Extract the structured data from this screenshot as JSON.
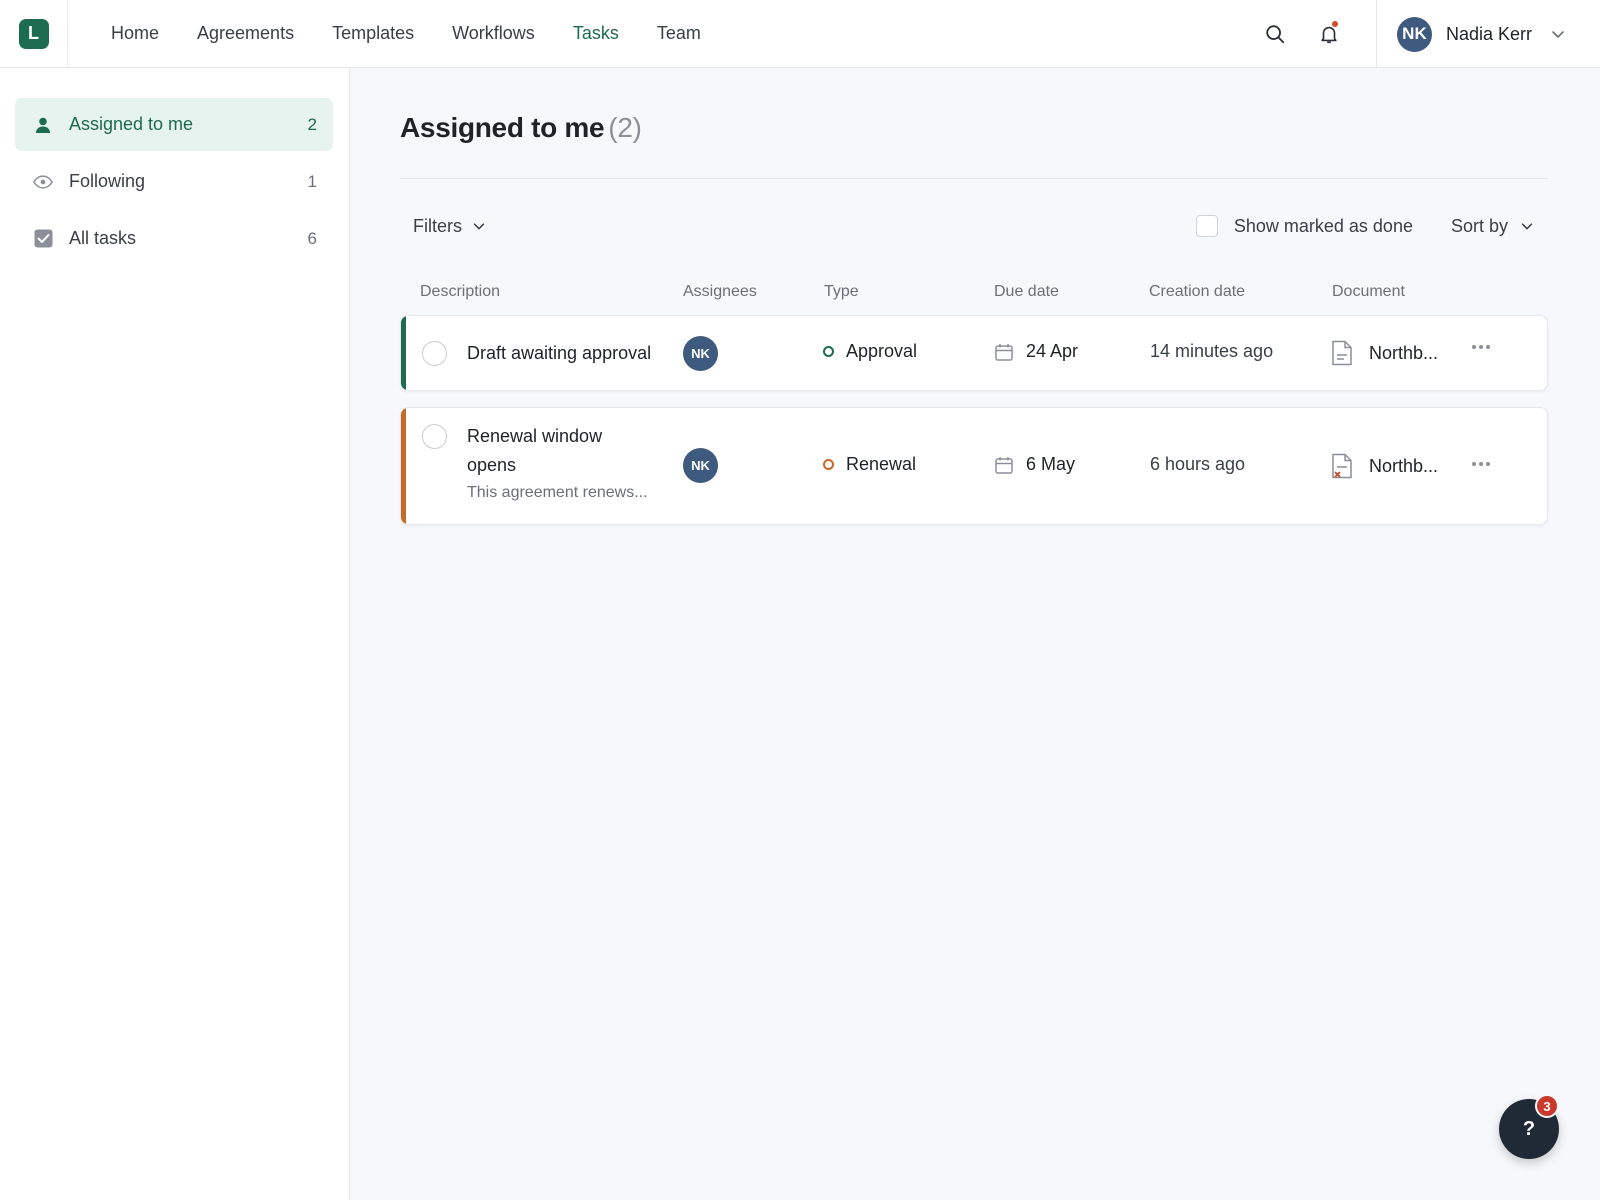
{
  "app": {
    "logo_letter": "L",
    "brand_color": "#1d6b50"
  },
  "nav": {
    "items": [
      {
        "label": "Home",
        "active": false
      },
      {
        "label": "Agreements",
        "active": false
      },
      {
        "label": "Templates",
        "active": false
      },
      {
        "label": "Workflows",
        "active": false
      },
      {
        "label": "Tasks",
        "active": true
      },
      {
        "label": "Team",
        "active": false
      }
    ]
  },
  "user": {
    "initials": "NK",
    "name": "Nadia Kerr"
  },
  "sidebar": {
    "items": [
      {
        "label": "Assigned to me",
        "count": "2",
        "icon": "person-icon",
        "active": true
      },
      {
        "label": "Following",
        "count": "1",
        "icon": "eye-icon",
        "active": false
      },
      {
        "label": "All tasks",
        "count": "6",
        "icon": "checkbox-icon",
        "active": false
      }
    ]
  },
  "main": {
    "title": "Assigned to me",
    "title_count": "(2)",
    "filters_label": "Filters",
    "show_done_label": "Show marked as done",
    "sort_label": "Sort by",
    "columns": {
      "description": "Description",
      "assignees": "Assignees",
      "type": "Type",
      "due": "Due date",
      "created": "Creation date",
      "document": "Document"
    },
    "tasks": [
      {
        "description": "Draft awaiting approval",
        "subtext": "",
        "assignee": "NK",
        "type": "Approval",
        "type_color": "#1d6b50",
        "due": "24 Apr",
        "created": "14 minutes ago",
        "document": "Northb...",
        "document_icon": "document-icon"
      },
      {
        "description_line1": "Renewal window",
        "description_line2": "opens",
        "subtext": "This agreement renews...",
        "assignee": "NK",
        "type": "Renewal",
        "type_color": "#c46a2a",
        "due": "6 May",
        "created": "6 hours ago",
        "document": "Northb...",
        "document_icon": "document-error-icon"
      }
    ]
  },
  "help": {
    "label": "?",
    "badge": "3"
  }
}
